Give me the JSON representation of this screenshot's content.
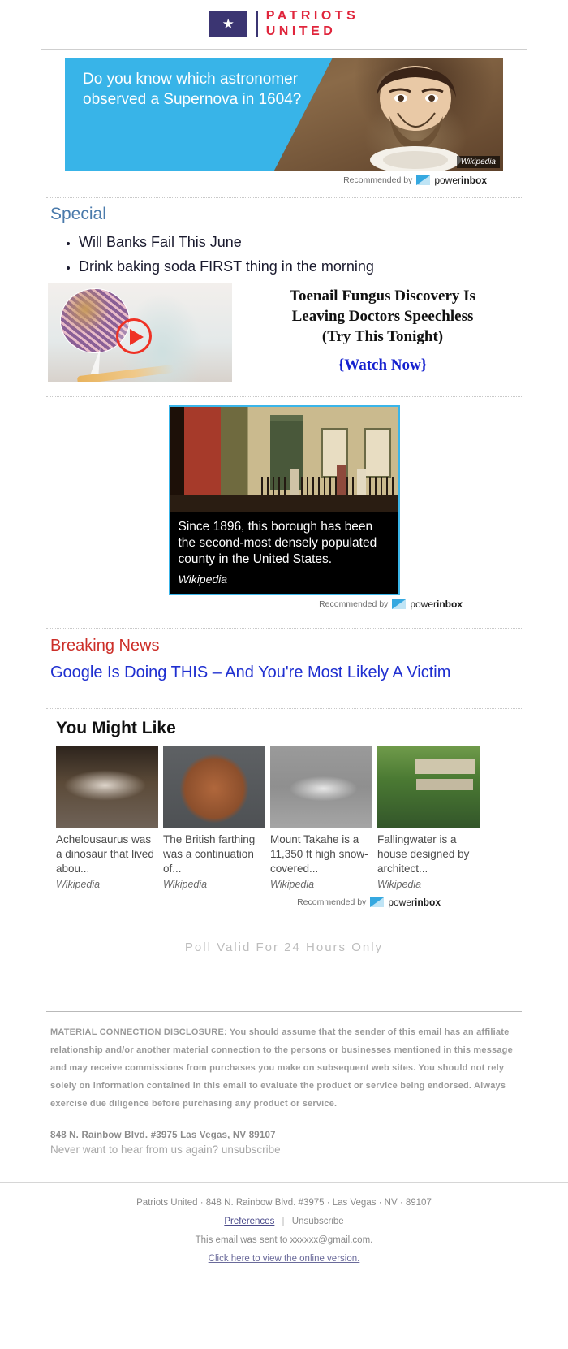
{
  "brand": {
    "flag_icon": "flag-star-icon",
    "name_line1": "PATRIOTS",
    "name_line2": "UNITED",
    "flag_color": "#3b3572",
    "text_color": "#e0253c"
  },
  "hero": {
    "question": "Do you know which astronomer observed a Supernova in 1604?",
    "credit": "Wikipedia",
    "panel_color": "#38b4e8"
  },
  "attribution": {
    "prefix": "Recommended by",
    "brand_light": "power",
    "brand_bold": "inbox",
    "mark_icon": "powerinbox-envelope-icon"
  },
  "special": {
    "heading": "Special",
    "heading_color": "#4a7aab",
    "items": [
      "Will Banks Fail This June",
      "Drink baking soda FIRST thing in the morning"
    ],
    "ad": {
      "image_alt": "toenail-fungus-foot-microscope",
      "play_icon": "play-button-icon",
      "title_line1": "Toenail Fungus Discovery Is",
      "title_line2": "Leaving Doctors Speechless",
      "title_line3": "(Try This Tonight)",
      "cta": "{Watch Now}",
      "cta_color": "#1521cf"
    }
  },
  "wiki_card": {
    "image_alt": "brooklyn-brownstone-street-1970s",
    "caption": "Since 1896, this borough has been the second-most densely populated county in the United States.",
    "source": "Wikipedia",
    "border_color": "#3ab5e9"
  },
  "breaking": {
    "heading": "Breaking News",
    "heading_color": "#cc2e28",
    "link": "Google Is Doing THIS – And You're Most Likely A Victim",
    "link_color": "#1f2fd0"
  },
  "you_might_like": {
    "heading": "You Might Like",
    "cards": [
      {
        "image_alt": "achelousaurus-skull-fossil",
        "text": "Achelousaurus was a dinosaur that lived abou...",
        "source": "Wikipedia"
      },
      {
        "image_alt": "british-farthing-copper-coin",
        "text": "The British farthing was a continuation of...",
        "source": "Wikipedia"
      },
      {
        "image_alt": "mount-takahe-aerial-photo",
        "text": "Mount Takahe is a 11,350 ft high snow-covered...",
        "source": "Wikipedia"
      },
      {
        "image_alt": "fallingwater-house-waterfall",
        "text": "Fallingwater is a house designed by architect...",
        "source": "Wikipedia"
      }
    ]
  },
  "poll_notice": "Poll Valid For 24 Hours Only",
  "disclosure": "MATERIAL CONNECTION DISCLOSURE: You should assume that the sender of this email has an affiliate relationship and/or another material connection to the persons or businesses mentioned in this message and may receive commissions from purchases you make on subsequent web sites. You should not rely solely on information contained in this email to evaluate the product or service being endorsed. Always exercise due diligence before purchasing any product or service.",
  "address_line": "848 N. Rainbow Blvd. #3975 Las Vegas, NV 89107",
  "unsubscribe_line": "Never want to hear from us again? unsubscribe",
  "footer": {
    "identity": "Patriots United · 848 N. Rainbow Blvd. #3975 · Las Vegas · NV · 89107",
    "preferences": "Preferences",
    "separator": "|",
    "unsubscribe": "Unsubscribe",
    "sent_to": "This email was sent to xxxxxx@gmail.com.",
    "online_version": "Click here to view the online version."
  }
}
